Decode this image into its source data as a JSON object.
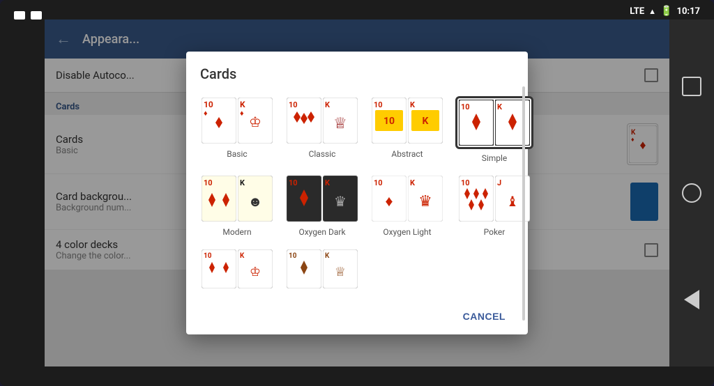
{
  "statusBar": {
    "time": "10:17",
    "lte": "LTE",
    "battery": "🔋"
  },
  "header": {
    "title": "Appeara...",
    "backLabel": "←"
  },
  "settings": {
    "disableAutocomplete": "Disable Autoco...",
    "sectionLabel": "Cards",
    "cardsLabel": "Cards",
    "cardsValue": "Basic",
    "cardBackgroundLabel": "Card backgrou...",
    "cardBackgroundSub": "Background num...",
    "fourColorDecks": "4 color decks",
    "fourColorSub": "Change the color..."
  },
  "modal": {
    "title": "Cards",
    "options": [
      {
        "id": "basic",
        "label": "Basic",
        "selected": false
      },
      {
        "id": "classic",
        "label": "Classic",
        "selected": false
      },
      {
        "id": "abstract",
        "label": "Abstract",
        "selected": false
      },
      {
        "id": "simple",
        "label": "Simple",
        "selected": true
      },
      {
        "id": "modern",
        "label": "Modern",
        "selected": false
      },
      {
        "id": "oxygen-dark",
        "label": "Oxygen Dark",
        "selected": false
      },
      {
        "id": "oxygen-light",
        "label": "Oxygen Light",
        "selected": false
      },
      {
        "id": "poker",
        "label": "Poker",
        "selected": false
      }
    ],
    "cancelLabel": "CANCEL"
  },
  "sidebar": {
    "squareIcon": "□",
    "circleIcon": "○",
    "triangleIcon": "◁"
  }
}
